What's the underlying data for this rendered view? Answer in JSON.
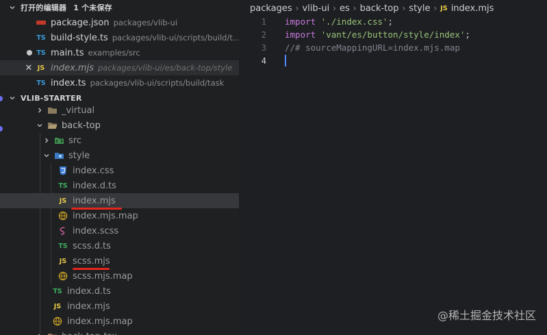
{
  "open_editors": {
    "title": "打开的编辑器",
    "unsaved": "1 个未保存",
    "items": [
      {
        "name": "package.json",
        "desc": "packages/vlib-ui",
        "icon": "npm-icon"
      },
      {
        "name": "build-style.ts",
        "desc": "packages/vlib-ui/scripts/build/t...",
        "icon": "ts-icon"
      },
      {
        "name": "main.ts",
        "desc": "examples/src",
        "icon": "ts-icon"
      },
      {
        "name": "index.mjs",
        "desc": "packages/vlib-ui/es/back-top/style",
        "icon": "js-icon"
      },
      {
        "name": "index.ts",
        "desc": "packages/vlib-ui/scripts/build/task",
        "icon": "ts-icon"
      }
    ]
  },
  "explorer": {
    "title": "VLIB-STARTER",
    "items": [
      {
        "name": "_virtual",
        "icon": "folder-icon"
      },
      {
        "name": "back-top",
        "icon": "folder-open-icon"
      },
      {
        "name": "src",
        "icon": "src-folder-icon"
      },
      {
        "name": "style",
        "icon": "style-folder-icon"
      },
      {
        "name": "index.css",
        "icon": "css-icon"
      },
      {
        "name": "index.d.ts",
        "icon": "ts-icon"
      },
      {
        "name": "index.mjs",
        "icon": "js-icon"
      },
      {
        "name": "index.mjs.map",
        "icon": "map-icon"
      },
      {
        "name": "index.scss",
        "icon": "scss-icon"
      },
      {
        "name": "scss.d.ts",
        "icon": "ts-icon"
      },
      {
        "name": "scss.mjs",
        "icon": "js-icon"
      },
      {
        "name": "scss.mjs.map",
        "icon": "map-icon"
      },
      {
        "name": "index.d.ts",
        "icon": "ts-icon"
      },
      {
        "name": "index.mjs",
        "icon": "js-icon"
      },
      {
        "name": "index.mjs.map",
        "icon": "map-icon"
      },
      {
        "name": "back-top-tsx",
        "icon": "folder-icon"
      }
    ]
  },
  "icons": {
    "ts": "TS",
    "js": "JS"
  },
  "breadcrumb": {
    "parts": [
      "packages",
      "vlib-ui",
      "es",
      "back-top",
      "style"
    ],
    "file": "index.mjs",
    "file_icon": "JS"
  },
  "code": {
    "lines": [
      {
        "num": "1",
        "kw": "import",
        "str": "'./index.css'",
        "end": ";"
      },
      {
        "num": "2",
        "kw": "import",
        "str": "'vant/es/button/style/index'",
        "end": ";"
      },
      {
        "num": "3",
        "comment": "//# sourceMappingURL=index.mjs.map"
      },
      {
        "num": "4"
      }
    ]
  },
  "watermark": "@稀土掘金技术社区",
  "colors": {
    "keyword": "#c678dd",
    "string": "#98c379",
    "comment": "#7f848e",
    "underline": "#e3271f"
  }
}
